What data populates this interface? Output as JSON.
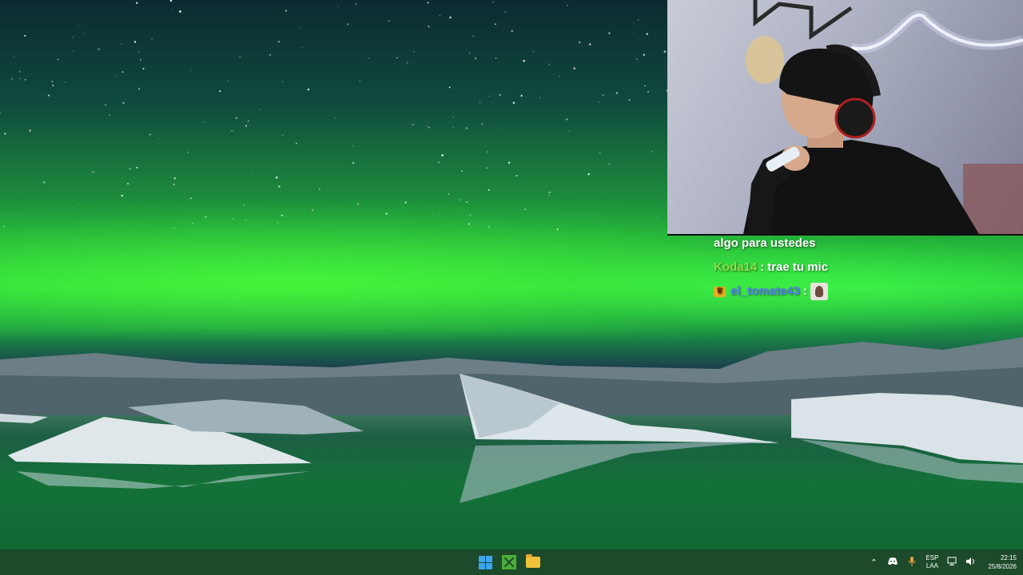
{
  "chat": {
    "messages": [
      {
        "user": "",
        "separator": "",
        "text": "algo para ustedes",
        "user_color": "#ffffff"
      },
      {
        "user": "Koda14",
        "separator": ":",
        "text": "trae tu mic",
        "user_color": "#8ee04a"
      },
      {
        "user": "el_tomate43",
        "separator": ":",
        "text": "",
        "user_color": "#5a7bff",
        "badge": "crown-badge",
        "emote": "face-emote"
      }
    ]
  },
  "taskbar": {
    "apps": [
      {
        "name": "start-button",
        "icon": "windows-icon"
      },
      {
        "name": "minecraft-app",
        "icon": "minecraft-icon"
      },
      {
        "name": "file-explorer-app",
        "icon": "folder-icon"
      }
    ],
    "tray": {
      "overflow_icon": "chevron-up-icon",
      "discord_icon": "discord-icon",
      "mic_icon": "microphone-icon",
      "language_top": "ESP",
      "language_bottom": "LAA",
      "network_icon": "network-icon",
      "volume_icon": "speaker-icon",
      "time": "22:15",
      "date": "25/8/2026"
    }
  },
  "colors": {
    "aurora": "#2bd93a",
    "taskbar": "#1c4a2a",
    "windows_blue": "#3aa6f0"
  }
}
